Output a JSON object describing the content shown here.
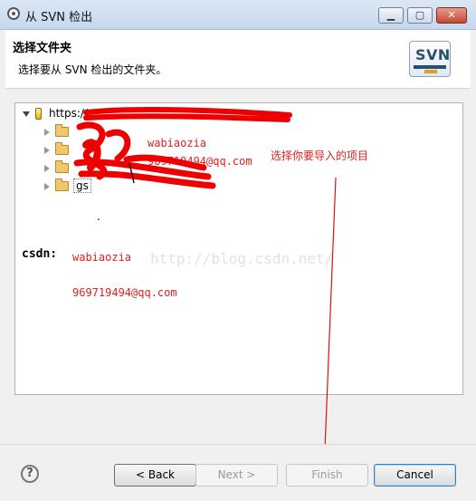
{
  "window": {
    "title": "从 SVN 检出",
    "min": "▁",
    "max": "▢",
    "close": "✕"
  },
  "header": {
    "title": "选择文件夹",
    "description": "选择要从 SVN 检出的文件夹。",
    "logo_text": "SVN"
  },
  "tree": {
    "root_label": "https://",
    "folders": [
      "",
      "",
      "",
      "gs"
    ],
    "dot": "."
  },
  "annotations": {
    "overlay_name": "wabiaozia",
    "overlay_email": "969719494@qq.com",
    "hint": "选择你要导入的项目",
    "csdn_label": "csdn:",
    "name": "wabiaozia",
    "email": "969719494@qq.com",
    "watermark": "http://blog.csdn.net/"
  },
  "footer": {
    "help": "?",
    "back": "< Back",
    "next": "Next >",
    "finish": "Finish",
    "cancel": "Cancel"
  },
  "colors": {
    "annotation": "#dd2222",
    "watermark": "#e2e2e2",
    "accent": "#3c7fb1"
  }
}
